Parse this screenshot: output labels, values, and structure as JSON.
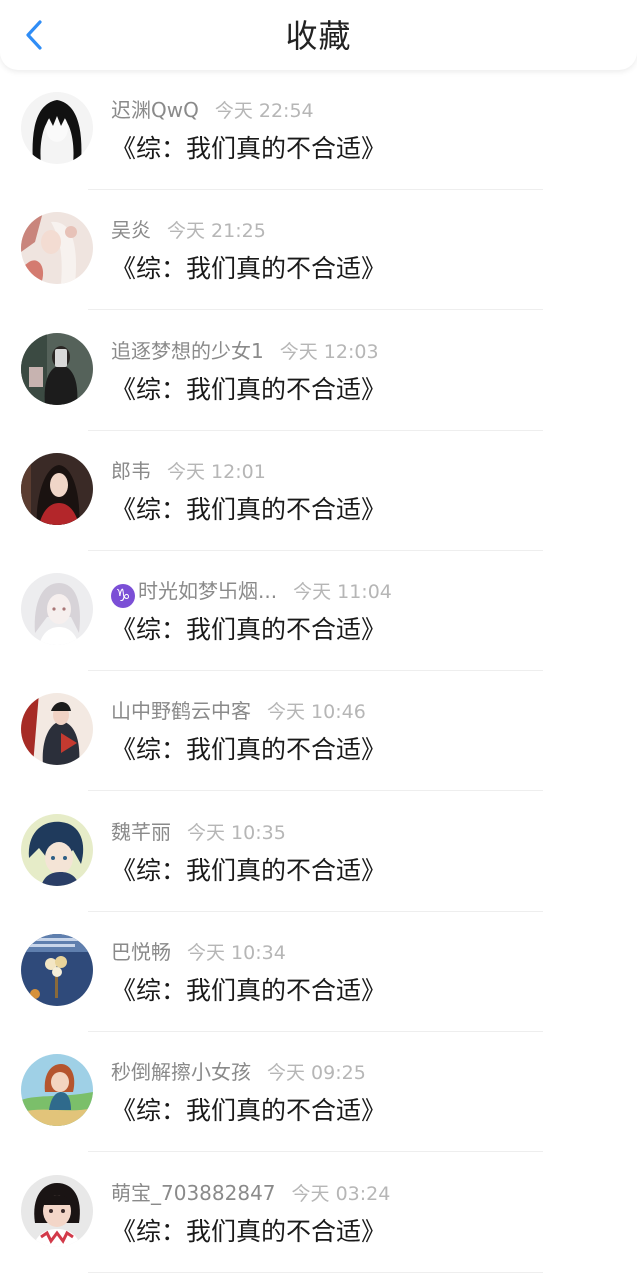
{
  "header": {
    "title": "收藏",
    "back_icon": "chevron-left-icon",
    "accent": "#2f8df6"
  },
  "items": [
    {
      "username": "迟渊QwQ",
      "time": "今天 22:54",
      "title": "《综：我们真的不合适》",
      "badge": ""
    },
    {
      "username": "吴炎",
      "time": "今天 21:25",
      "title": "《综：我们真的不合适》",
      "badge": ""
    },
    {
      "username": "追逐梦想的少女1",
      "time": "今天 12:03",
      "title": "《综：我们真的不合适》",
      "badge": ""
    },
    {
      "username": "郎韦",
      "time": "今天 12:01",
      "title": "《综：我们真的不合适》",
      "badge": ""
    },
    {
      "username": "时光如梦卐烟...",
      "time": "今天 11:04",
      "title": "《综：我们真的不合适》",
      "badge": "♑"
    },
    {
      "username": "山中野鹤云中客",
      "time": "今天 10:46",
      "title": "《综：我们真的不合适》",
      "badge": ""
    },
    {
      "username": "魏芊丽",
      "time": "今天 10:35",
      "title": "《综：我们真的不合适》",
      "badge": ""
    },
    {
      "username": "巴悦畅",
      "time": "今天 10:34",
      "title": "《综：我们真的不合适》",
      "badge": ""
    },
    {
      "username": "秒倒解擦小女孩",
      "time": "今天 09:25",
      "title": "《综：我们真的不合适》",
      "badge": ""
    },
    {
      "username": "萌宝_703882847",
      "time": "今天 03:24",
      "title": "《综：我们真的不合适》",
      "badge": ""
    }
  ]
}
